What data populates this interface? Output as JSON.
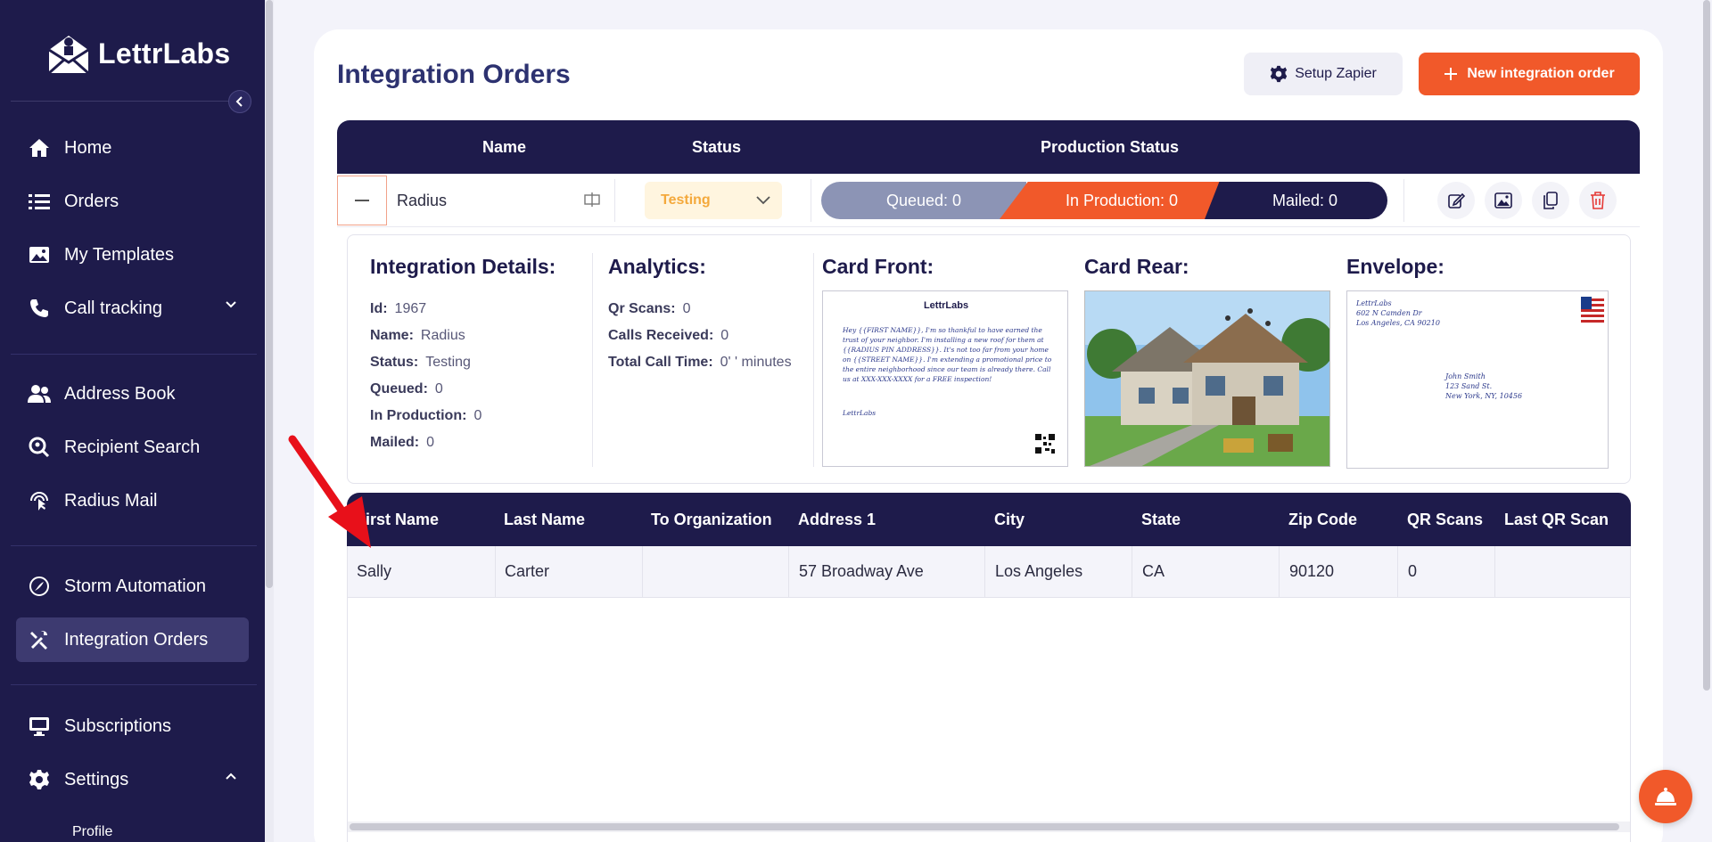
{
  "app": {
    "name": "LettrLabs"
  },
  "sidebar": {
    "items": [
      {
        "label": "Home",
        "icon": "home-icon"
      },
      {
        "label": "Orders",
        "icon": "list-icon"
      },
      {
        "label": "My Templates",
        "icon": "image-icon"
      },
      {
        "label": "Call tracking",
        "icon": "phone-icon"
      },
      {
        "label": "Address Book",
        "icon": "users-icon"
      },
      {
        "label": "Recipient Search",
        "icon": "search-location-icon"
      },
      {
        "label": "Radius Mail",
        "icon": "radius-pointer-icon"
      },
      {
        "label": "Storm Automation",
        "icon": "storm-icon"
      },
      {
        "label": "Integration Orders",
        "icon": "tools-icon"
      },
      {
        "label": "Subscriptions",
        "icon": "monitor-icon"
      },
      {
        "label": "Settings",
        "icon": "gear-icon"
      }
    ],
    "sub_items": [
      "Profile"
    ],
    "active": "Integration Orders"
  },
  "page": {
    "title": "Integration Orders",
    "setup_zapier": "Setup Zapier",
    "new_order": "New integration order"
  },
  "orders_table": {
    "headers": {
      "name": "Name",
      "status": "Status",
      "production": "Production Status"
    },
    "row": {
      "name": "Radius",
      "status": "Testing",
      "queued": "Queued:  0",
      "in_production": "In Production:  0",
      "mailed": "Mailed:  0"
    }
  },
  "details": {
    "integration_title": "Integration Details:",
    "id_label": "Id:",
    "id_value": "1967",
    "name_label": "Name:",
    "name_value": "Radius",
    "status_label": "Status:",
    "status_value": "Testing",
    "queued_label": "Queued:",
    "queued_value": "0",
    "inprod_label": "In Production:",
    "inprod_value": "0",
    "mailed_label": "Mailed:",
    "mailed_value": "0",
    "analytics_title": "Analytics:",
    "qr_label": "Qr Scans:",
    "qr_value": "0",
    "calls_label": "Calls Received:",
    "calls_value": "0",
    "calltime_label": "Total Call Time:",
    "calltime_value": "0' ' minutes",
    "card_front_title": "Card Front:",
    "card_rear_title": "Card Rear:",
    "envelope_title": "Envelope:",
    "card_front": {
      "brand": "LettrLabs",
      "body": "Hey {{FIRST NAME}}, I'm so thankful to have earned the trust of your neighbor. I'm installing a new roof for them at {{RADIUS PIN ADDRESS}}. It's not too far from your home on {{STREET NAME}}. I'm extending a promotional price to the entire neighborhood since our team is already there. Call us at XXX-XXX-XXXX for a FREE inspection!",
      "signature": "LettrLabs"
    },
    "envelope": {
      "return_lines": [
        "LettrLabs",
        "602 N Camden Dr",
        "Los Angeles, CA 90210"
      ],
      "recipient_lines": [
        "John Smith",
        "123 Sand St.",
        "New York, NY, 10456"
      ]
    }
  },
  "recipients": {
    "headers": [
      "First Name",
      "Last Name",
      "To Organization",
      "Address 1",
      "City",
      "State",
      "Zip Code",
      "QR Scans",
      "Last QR Scan"
    ],
    "rows": [
      [
        "Sally",
        "Carter",
        "",
        "57 Broadway Ave",
        "Los Angeles",
        "CA",
        "90120",
        "0",
        ""
      ]
    ]
  },
  "colors": {
    "navy": "#1e1b4b",
    "orange": "#f1592a",
    "amber": "#f4a93c",
    "slate": "#8c94b5"
  }
}
